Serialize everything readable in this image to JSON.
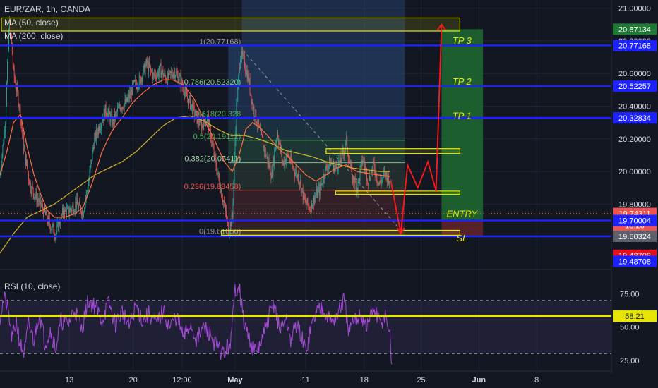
{
  "legend": {
    "title": "EUR/ZAR, 1h, OANDA",
    "ma50": "MA (50, close)",
    "ma200": "MA (200, close)",
    "rsi": "RSI (10, close)"
  },
  "colors": {
    "background": "#131722",
    "grid": "#1f2532",
    "candle_up": "#26a69a",
    "candle_down": "#ef5350",
    "ma50": "#ff7043",
    "ma200": "#d4b72c",
    "level_line": "#1b22ff",
    "zone_border": "#e6e600",
    "path": "#ff1a1a",
    "rsi": "#a24ad4",
    "rsi_level": "#e6e600"
  },
  "chart_data": {
    "type": "candlestick",
    "symbol": "EUR/ZAR",
    "timeframe": "1h",
    "source": "OANDA",
    "ylim": [
      19.4,
      21.05
    ],
    "price_ticks": [
      "21.00000",
      "20.80000",
      "20.60000",
      "20.40000",
      "20.20000",
      "20.00000",
      "19.80000",
      "19.60000"
    ],
    "time_ticks": [
      {
        "label": "13",
        "bar": 102
      },
      {
        "label": "20",
        "bar": 196
      },
      {
        "label": "12:00",
        "bar": 268
      },
      {
        "label": "May",
        "bar": 346
      },
      {
        "label": "11",
        "bar": 450
      },
      {
        "label": "18",
        "bar": 536
      },
      {
        "label": "25",
        "bar": 620
      },
      {
        "label": "Jun",
        "bar": 705
      },
      {
        "label": "8",
        "bar": 790
      }
    ],
    "anchors": [
      [
        0,
        19.98
      ],
      [
        8,
        20.32
      ],
      [
        14,
        20.95
      ],
      [
        20,
        20.6
      ],
      [
        28,
        20.42
      ],
      [
        36,
        20.12
      ],
      [
        44,
        19.92
      ],
      [
        52,
        19.85
      ],
      [
        60,
        19.8
      ],
      [
        70,
        19.7
      ],
      [
        82,
        19.62
      ],
      [
        92,
        19.74
      ],
      [
        102,
        19.76
      ],
      [
        112,
        19.8
      ],
      [
        122,
        19.76
      ],
      [
        130,
        19.92
      ],
      [
        138,
        20.18
      ],
      [
        146,
        20.28
      ],
      [
        156,
        20.38
      ],
      [
        166,
        20.3
      ],
      [
        176,
        20.4
      ],
      [
        186,
        20.42
      ],
      [
        196,
        20.52
      ],
      [
        206,
        20.56
      ],
      [
        216,
        20.66
      ],
      [
        226,
        20.58
      ],
      [
        236,
        20.62
      ],
      [
        246,
        20.56
      ],
      [
        256,
        20.62
      ],
      [
        266,
        20.55
      ],
      [
        276,
        20.45
      ],
      [
        286,
        20.36
      ],
      [
        296,
        20.28
      ],
      [
        306,
        20.33
      ],
      [
        314,
        20.12
      ],
      [
        322,
        19.95
      ],
      [
        330,
        19.8
      ],
      [
        336,
        19.64
      ],
      [
        342,
        19.72
      ],
      [
        348,
        20.4
      ],
      [
        354,
        20.72
      ],
      [
        360,
        20.66
      ],
      [
        366,
        20.56
      ],
      [
        372,
        20.4
      ],
      [
        380,
        20.28
      ],
      [
        390,
        20.12
      ],
      [
        400,
        19.98
      ],
      [
        408,
        20.25
      ],
      [
        416,
        20.05
      ],
      [
        424,
        20.1
      ],
      [
        432,
        20.02
      ],
      [
        440,
        19.96
      ],
      [
        448,
        19.82
      ],
      [
        456,
        19.78
      ],
      [
        462,
        19.84
      ],
      [
        470,
        19.88
      ],
      [
        478,
        20.0
      ],
      [
        486,
        20.06
      ],
      [
        494,
        20.02
      ],
      [
        502,
        20.08
      ],
      [
        510,
        20.18
      ],
      [
        518,
        19.96
      ],
      [
        526,
        19.9
      ],
      [
        534,
        20.08
      ],
      [
        542,
        19.95
      ],
      [
        550,
        20.04
      ],
      [
        558,
        19.92
      ],
      [
        566,
        19.98
      ],
      [
        574,
        19.96
      ]
    ],
    "ma50_anchors": [
      [
        0,
        19.98
      ],
      [
        10,
        20.12
      ],
      [
        20,
        20.3
      ],
      [
        30,
        20.35
      ],
      [
        40,
        20.15
      ],
      [
        50,
        19.98
      ],
      [
        60,
        19.86
      ],
      [
        70,
        19.76
      ],
      [
        80,
        19.72
      ],
      [
        95,
        19.72
      ],
      [
        110,
        19.74
      ],
      [
        122,
        19.78
      ],
      [
        135,
        19.92
      ],
      [
        150,
        20.12
      ],
      [
        165,
        20.25
      ],
      [
        180,
        20.33
      ],
      [
        195,
        20.42
      ],
      [
        210,
        20.48
      ],
      [
        225,
        20.53
      ],
      [
        240,
        20.56
      ],
      [
        255,
        20.56
      ],
      [
        270,
        20.53
      ],
      [
        285,
        20.45
      ],
      [
        300,
        20.32
      ],
      [
        315,
        20.2
      ],
      [
        330,
        20.06
      ],
      [
        342,
        20.0
      ],
      [
        352,
        20.1
      ],
      [
        362,
        20.26
      ],
      [
        372,
        20.3
      ],
      [
        385,
        20.26
      ],
      [
        398,
        20.2
      ],
      [
        410,
        20.14
      ],
      [
        422,
        20.1
      ],
      [
        436,
        20.04
      ],
      [
        450,
        19.98
      ],
      [
        465,
        19.94
      ],
      [
        480,
        19.98
      ],
      [
        495,
        20.02
      ],
      [
        510,
        20.04
      ],
      [
        525,
        20.0
      ],
      [
        540,
        19.99
      ],
      [
        555,
        19.98
      ],
      [
        574,
        19.97
      ]
    ],
    "ma200_anchors": [
      [
        0,
        19.5
      ],
      [
        20,
        19.62
      ],
      [
        40,
        19.72
      ],
      [
        60,
        19.76
      ],
      [
        80,
        19.8
      ],
      [
        100,
        19.86
      ],
      [
        120,
        19.92
      ],
      [
        140,
        19.98
      ],
      [
        160,
        20.02
      ],
      [
        180,
        20.06
      ],
      [
        200,
        20.12
      ],
      [
        220,
        20.2
      ],
      [
        240,
        20.28
      ],
      [
        260,
        20.33
      ],
      [
        280,
        20.34
      ],
      [
        300,
        20.31
      ],
      [
        320,
        20.26
      ],
      [
        340,
        20.22
      ],
      [
        360,
        20.22
      ],
      [
        380,
        20.2
      ],
      [
        400,
        20.17
      ],
      [
        420,
        20.13
      ],
      [
        440,
        20.11
      ],
      [
        460,
        20.09
      ],
      [
        480,
        20.06
      ],
      [
        500,
        20.04
      ],
      [
        520,
        20.02
      ],
      [
        540,
        20.01
      ],
      [
        560,
        20.0
      ],
      [
        574,
        20.0
      ]
    ],
    "fib": {
      "levels": [
        {
          "label": "1(20.77168)",
          "value": 20.77168,
          "color": "#9598a1"
        },
        {
          "label": "0.786(20.52320)",
          "value": 20.5232,
          "color": "#81c784"
        },
        {
          "label": "0.618(20.328",
          "value": 20.328,
          "color": "#4caf50"
        },
        {
          "label": "0.5(20.19112)",
          "value": 20.19112,
          "color": "#4caf50"
        },
        {
          "label": "0.382(20.05411)",
          "value": 20.05411,
          "color": "#a5d6a7"
        },
        {
          "label": "0.236(19.88458)",
          "value": 19.88458,
          "color": "#ef5350"
        },
        {
          "label": "0(19.61056)",
          "value": 19.61056,
          "color": "#9598a1"
        }
      ]
    },
    "horizontal_levels": [
      20.77168,
      20.52257,
      20.32834,
      19.70004,
      19.60324
    ],
    "zones": [
      {
        "from_bar": 2,
        "to_bar": 677,
        "low": 20.86,
        "high": 20.94
      },
      {
        "from_bar": 480,
        "to_bar": 677,
        "low": 20.11,
        "high": 20.14
      },
      {
        "from_bar": 494,
        "to_bar": 677,
        "low": 19.86,
        "high": 19.88
      },
      {
        "from_bar": 326,
        "to_bar": 677,
        "low": 19.61,
        "high": 19.64
      }
    ],
    "projection_path": [
      [
        575,
        19.95
      ],
      [
        590,
        19.62
      ],
      [
        600,
        20.04
      ],
      [
        615,
        19.9
      ],
      [
        630,
        20.06
      ],
      [
        642,
        19.88
      ],
      [
        650,
        20.9
      ]
    ],
    "trade_labels": [
      {
        "text": "TP 3",
        "value": 20.8
      },
      {
        "text": "TP 2",
        "value": 20.55
      },
      {
        "text": "TP 1",
        "value": 20.34
      },
      {
        "text": "ENTRY",
        "value": 19.74
      },
      {
        "text": "SL",
        "value": 19.59
      }
    ],
    "price_badges": [
      {
        "text": "20.87134",
        "value": 20.87134,
        "bg": "#1e7a34",
        "fg": "#ffffff"
      },
      {
        "text": "20.77168",
        "value": 20.77168,
        "bg": "#1b22ff",
        "fg": "#ffffff"
      },
      {
        "text": "20.52257",
        "value": 20.52257,
        "bg": "#1b22ff",
        "fg": "#ffffff"
      },
      {
        "text": "20.32834",
        "value": 20.32834,
        "bg": "#1b22ff",
        "fg": "#ffffff"
      },
      {
        "text": "19.74311",
        "value": 19.74311,
        "bg": "#ef5350",
        "fg": "#ffffff"
      },
      {
        "text": "18:26",
        "value": 19.67,
        "bg": "#ef5350",
        "fg": "#ffffff"
      },
      {
        "text": "19.70004",
        "value": 19.70004,
        "bg": "#1b22ff",
        "fg": "#ffffff"
      },
      {
        "text": "19.60324",
        "value": 19.60324,
        "bg": "#5d606b",
        "fg": "#ffffff"
      },
      {
        "text": "19.48708",
        "value": 19.48708,
        "bg": "#e01224",
        "fg": "#ffffff"
      },
      {
        "text": "19.48708",
        "value": 19.45,
        "bg": "#1b22ff",
        "fg": "#ffffff"
      }
    ],
    "rsi": {
      "period": 10,
      "ylim": [
        18,
        90
      ],
      "ticks": [
        "75.00",
        "50.00",
        "25.00"
      ],
      "upper": 70,
      "lower": 30,
      "level": 58.21,
      "level_label": "58.21",
      "anchors": [
        [
          0,
          58
        ],
        [
          6,
          72
        ],
        [
          12,
          62
        ],
        [
          18,
          40
        ],
        [
          24,
          55
        ],
        [
          30,
          36
        ],
        [
          36,
          30
        ],
        [
          42,
          52
        ],
        [
          50,
          40
        ],
        [
          58,
          62
        ],
        [
          66,
          38
        ],
        [
          74,
          48
        ],
        [
          82,
          34
        ],
        [
          90,
          55
        ],
        [
          100,
          52
        ],
        [
          110,
          64
        ],
        [
          120,
          48
        ],
        [
          130,
          70
        ],
        [
          140,
          66
        ],
        [
          150,
          55
        ],
        [
          160,
          68
        ],
        [
          170,
          52
        ],
        [
          180,
          62
        ],
        [
          190,
          50
        ],
        [
          200,
          66
        ],
        [
          210,
          55
        ],
        [
          220,
          60
        ],
        [
          230,
          52
        ],
        [
          240,
          62
        ],
        [
          250,
          50
        ],
        [
          260,
          58
        ],
        [
          270,
          42
        ],
        [
          280,
          52
        ],
        [
          290,
          40
        ],
        [
          300,
          50
        ],
        [
          310,
          44
        ],
        [
          320,
          34
        ],
        [
          330,
          30
        ],
        [
          340,
          40
        ],
        [
          346,
          78
        ],
        [
          352,
          82
        ],
        [
          358,
          56
        ],
        [
          366,
          42
        ],
        [
          376,
          30
        ],
        [
          386,
          40
        ],
        [
          396,
          58
        ],
        [
          404,
          68
        ],
        [
          412,
          46
        ],
        [
          420,
          58
        ],
        [
          428,
          40
        ],
        [
          436,
          52
        ],
        [
          444,
          42
        ],
        [
          450,
          32
        ],
        [
          458,
          50
        ],
        [
          466,
          62
        ],
        [
          476,
          66
        ],
        [
          486,
          54
        ],
        [
          496,
          58
        ],
        [
          506,
          70
        ],
        [
          514,
          46
        ],
        [
          522,
          54
        ],
        [
          530,
          60
        ],
        [
          540,
          50
        ],
        [
          550,
          64
        ],
        [
          560,
          52
        ],
        [
          568,
          60
        ],
        [
          574,
          42
        ],
        [
          577,
          22
        ]
      ]
    }
  }
}
